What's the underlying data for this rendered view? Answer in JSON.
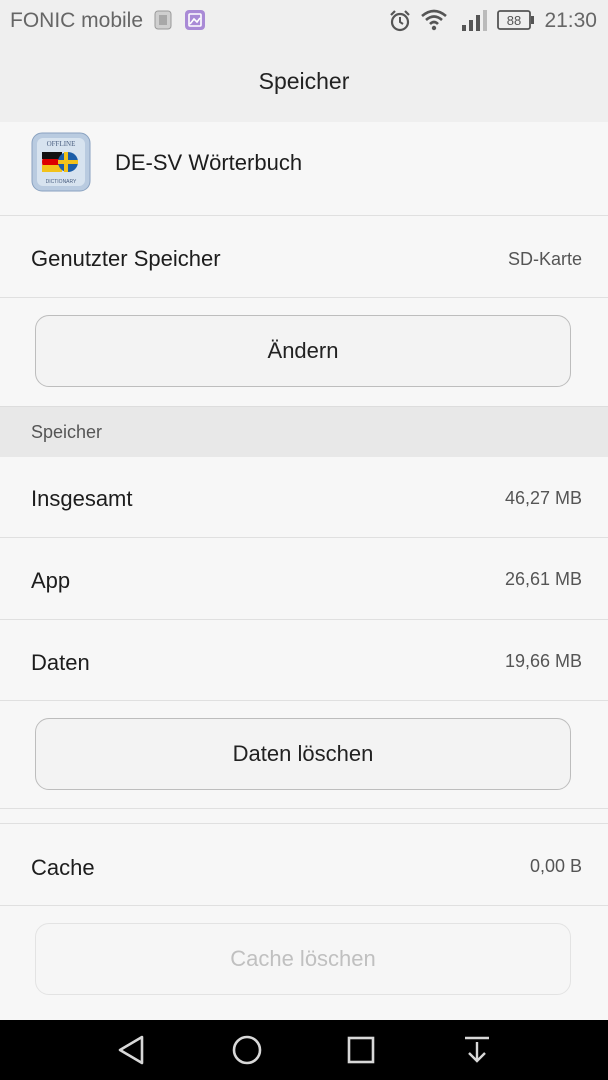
{
  "status_bar": {
    "carrier": "FONIC mobile",
    "battery": "88",
    "time": "21:30",
    "icons": [
      "sim-icon",
      "gallery-notification-icon",
      "alarm-icon",
      "wifi-icon",
      "signal-icon",
      "battery-icon"
    ]
  },
  "header": {
    "title": "Speicher"
  },
  "app": {
    "name": "DE-SV Wörterbuch",
    "icon": "dictionary-app-icon"
  },
  "storage_used": {
    "label": "Genutzter Speicher",
    "value": "SD-Karte"
  },
  "buttons": {
    "change": "Ändern",
    "clear_data": "Daten löschen",
    "clear_cache": "Cache löschen"
  },
  "section": {
    "label": "Speicher"
  },
  "rows": {
    "total": {
      "label": "Insgesamt",
      "value": "46,27 MB"
    },
    "app": {
      "label": "App",
      "value": "26,61 MB"
    },
    "data": {
      "label": "Daten",
      "value": "19,66 MB"
    },
    "cache": {
      "label": "Cache",
      "value": "0,00 B"
    }
  },
  "nav": {
    "icons": [
      "back-icon",
      "home-icon",
      "recents-icon",
      "notification-pull-icon"
    ]
  },
  "colors": {
    "accent_flag_blue": "#1c5ea8",
    "accent_flag_yellow": "#f2c21a"
  }
}
